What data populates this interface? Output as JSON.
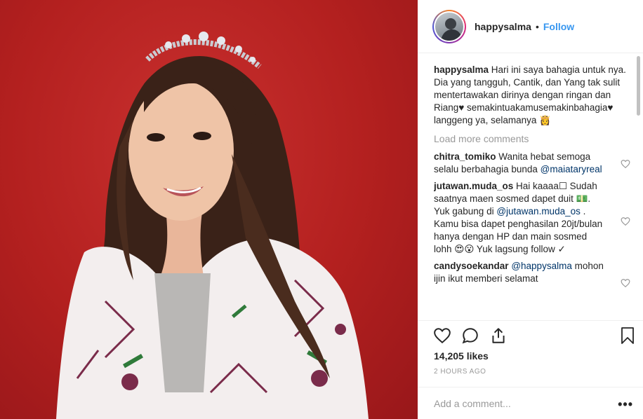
{
  "post": {
    "username": "happysalma",
    "separator": "•",
    "follow_label": "Follow",
    "caption_user": "happysalma",
    "caption_text": " Hari ini saya bahagia untuk nya. Dia yang tangguh, Cantik, dan Yang tak sulit mentertawakan dirinya dengan ringan dan Riang♥ semakintuakamusemakinbahagia♥ langgeng ya, selamanya 👸",
    "load_more": "Load more comments",
    "comments": [
      {
        "user": "chitra_tomiko",
        "text": " Wanita hebat semoga selalu berbahagia bunda ",
        "mention": "@maiataryreal",
        "after": ""
      },
      {
        "user": "jutawan.muda_os",
        "text": " Hai kaaaa☐ Sudah saatnya maen sosmed dapet duit 💵. Yuk gabung di ",
        "mention": "@jutawan.muda_os",
        "after": " . Kamu bisa dapet penghasilan 20jt/bulan hanya dengan HP dan main sosmed lohh 😍😮 Yuk lagsung follow ✓"
      },
      {
        "user": "candysoekandar",
        "text": " ",
        "mention": "@happysalma",
        "after": " mohon ijin ikut memberi selamat"
      }
    ],
    "likes": "14,205 likes",
    "time": "2 HOURS AGO",
    "add_comment_placeholder": "Add a comment...",
    "more_label": "•••"
  },
  "icons": {
    "like": "heart-icon",
    "comment": "comment-icon",
    "share": "share-icon",
    "save": "bookmark-icon"
  },
  "colors": {
    "accent": "#3897f0",
    "background_photo": "#b3201f",
    "text": "#262626",
    "muted": "#999999"
  }
}
